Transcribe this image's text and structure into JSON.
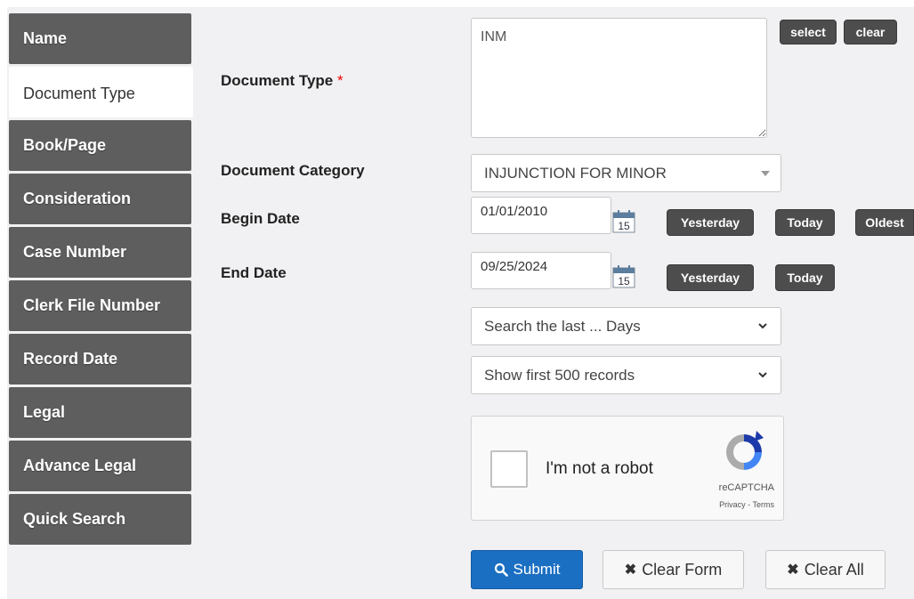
{
  "sidebar": {
    "items": [
      {
        "label": "Name"
      },
      {
        "label": "Document Type"
      },
      {
        "label": "Book/Page"
      },
      {
        "label": "Consideration"
      },
      {
        "label": "Case Number"
      },
      {
        "label": "Clerk File Number"
      },
      {
        "label": "Record Date"
      },
      {
        "label": "Legal"
      },
      {
        "label": "Advance Legal"
      },
      {
        "label": "Quick Search"
      }
    ],
    "active_index": 1
  },
  "form": {
    "document_type": {
      "label": "Document Type",
      "required_mark": "*",
      "value": "INM",
      "select_label": "select",
      "clear_label": "clear"
    },
    "document_category": {
      "label": "Document Category",
      "value": "INJUNCTION FOR MINOR"
    },
    "begin_date": {
      "label": "Begin Date",
      "value": "01/01/2010",
      "calendar_day": "15",
      "yesterday_label": "Yesterday",
      "today_label": "Today",
      "oldest_label": "Oldest"
    },
    "end_date": {
      "label": "End Date",
      "value": "09/25/2024",
      "calendar_day": "15",
      "yesterday_label": "Yesterday",
      "today_label": "Today"
    },
    "search_last_days": {
      "value": "Search the last ... Days"
    },
    "show_records": {
      "value": "Show first 500 records"
    }
  },
  "captcha": {
    "text": "I'm not a robot",
    "brand": "reCAPTCHA",
    "privacy": "Privacy",
    "separator": " - ",
    "terms": "Terms"
  },
  "actions": {
    "submit_label": "Submit",
    "clear_form_label": "Clear Form",
    "clear_all_label": "Clear All"
  },
  "colors": {
    "sidebar_bg": "#5e5e5e",
    "primary": "#1b6fc2",
    "dark_button": "#4d4d4d",
    "required": "#ee0000"
  }
}
